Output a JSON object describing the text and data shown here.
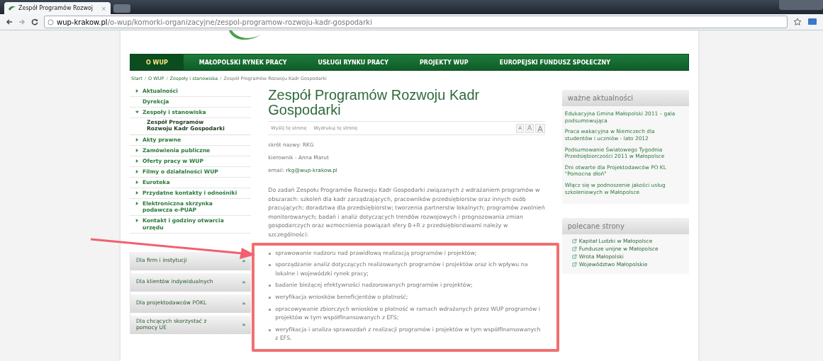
{
  "browser": {
    "tab_title": "Zespół Programów Rozwoj",
    "tab_close": "×",
    "url_host": "wup-krakow.pl",
    "url_path": "/o-wup/komorki-organizacyjne/zespol-programow-rozwoju-kadr-gospodarki"
  },
  "nav": [
    {
      "label": "O WUP",
      "selected": true
    },
    {
      "label": "MAŁOPOLSKI RYNEK PRACY",
      "selected": false
    },
    {
      "label": "USŁUGI RYNKU PRACY",
      "selected": false
    },
    {
      "label": "PROJEKTY WUP",
      "selected": false
    },
    {
      "label": "EUROPEJSKI FUNDUSZ SPOŁECZNY",
      "selected": false
    }
  ],
  "breadcrumb": {
    "separator": "/",
    "items": [
      "Start",
      "O WUP",
      "Zespoły i stanowiska",
      "Zespół Programów Rozwoju Kadr Gospodarki"
    ]
  },
  "sidebar": {
    "items": [
      {
        "label": "Aktualności",
        "kind": "folder",
        "expanded": false
      },
      {
        "label": "Dyrekcja",
        "kind": "page"
      },
      {
        "label": "Zespoły i stanowiska",
        "kind": "folder",
        "expanded": true,
        "children": [
          {
            "label": "Zespół Programów Rozwoju Kadr Gospodarki"
          }
        ]
      },
      {
        "label": "Akty prawne",
        "kind": "folder",
        "expanded": false
      },
      {
        "label": "Zamówienia publiczne",
        "kind": "folder",
        "expanded": false
      },
      {
        "label": "Oferty pracy w WUP",
        "kind": "folder",
        "expanded": false
      },
      {
        "label": "Filmy o działalności WUP",
        "kind": "folder",
        "expanded": false
      },
      {
        "label": "Euroteka",
        "kind": "folder",
        "expanded": false
      },
      {
        "label": "Przydatne kontakty i odnośniki",
        "kind": "folder",
        "expanded": false
      },
      {
        "label": "Elektroniczna skrzynka podawcza e-PUAP",
        "kind": "folder",
        "expanded": false
      },
      {
        "label": "Kontakt i godziny otwarcia urzędu",
        "kind": "folder",
        "expanded": false
      }
    ],
    "audience": [
      {
        "label": "Dla firm i instytucji",
        "arrow": "»"
      },
      {
        "label": "Dla klientów indywidualnych",
        "arrow": "»"
      },
      {
        "label": "Dla projektodawców POKL",
        "arrow": "»"
      },
      {
        "label": "Dla chcących skorzystać z pomocy UE",
        "arrow": "»"
      }
    ]
  },
  "article": {
    "title": "Zespół Programów Rozwoju Kadr Gospodarki",
    "tools": [
      "Wyślij tę stronę",
      "Wydrukuj tę stronę"
    ],
    "font_sizes": [
      "A",
      "A",
      "A"
    ],
    "facts": [
      {
        "text": "skrót nazwy: RKG"
      },
      {
        "text": "kierownik - Anna Marut"
      },
      {
        "text": "email:",
        "link": "rkg@wup-krakow.pl"
      }
    ],
    "intro": "Do zadań Zespołu Programów Rozwoju Kadr Gospodarki związanych z wdrażaniem programów w obszarach: szkoleń dla kadr zarządzających, pracowników przedsiębiorstw oraz innych osób pracujących;  doradztwa dla przedsiębiorstw; tworzenia partnerstw lokalnych; programów zwolnień monitorowanych; badań i analiz dotyczących trendów rozwojowych i prognozowania zmian gospodarczych oraz wzmocnienia powiązań sfery B+R z przedsiębiorstwami należy w szczególności:",
    "duties": [
      "sprawowanie nadzoru nad prawidłową realizacją programów i projektów;",
      "sporządzanie analiz dotyczących realizowanych programów i projektów oraz ich wpływu na lokalne i wojewódzki rynek pracy;",
      "badanie bieżącej efektywności nadzorowanych programów i projektów;",
      "weryfikacja wniosków beneficjentów o płatność;",
      "opracowywanie zbiorczych wniosków o płatność w ramach wdrażanych przez WUP programów i projektów w tym współfinansowanych z EFS;",
      "weryfikacja i analiza sprawozdań z realizacji programów i projektów w tym współfinansowanych z EFS."
    ]
  },
  "right": {
    "news": {
      "title": "ważne aktualności",
      "items": [
        "Edukacyjna Gmina Małopolski 2011 – gala podsumowująca",
        "Praca wakacyjna w Niemczech dla studentów i uczniów - lato 2012",
        "Podsumowanie Światowego Tygodnia Przedsiębiorczości 2011 w Małopolsce",
        "Dni otwarte dla Projektodawców PO KL \"Pomocna dłoń\"",
        "Włącz się w podnoszenie jakości usług szkoleniowych w Małopolsce"
      ]
    },
    "recommended": {
      "title": "polecane strony",
      "items": [
        "Kapitał Ludzki w Małopolsce",
        "Fundusze unijne w Małopolsce",
        "Wrota Małopolski",
        "Województwo Małopolskie"
      ]
    }
  }
}
